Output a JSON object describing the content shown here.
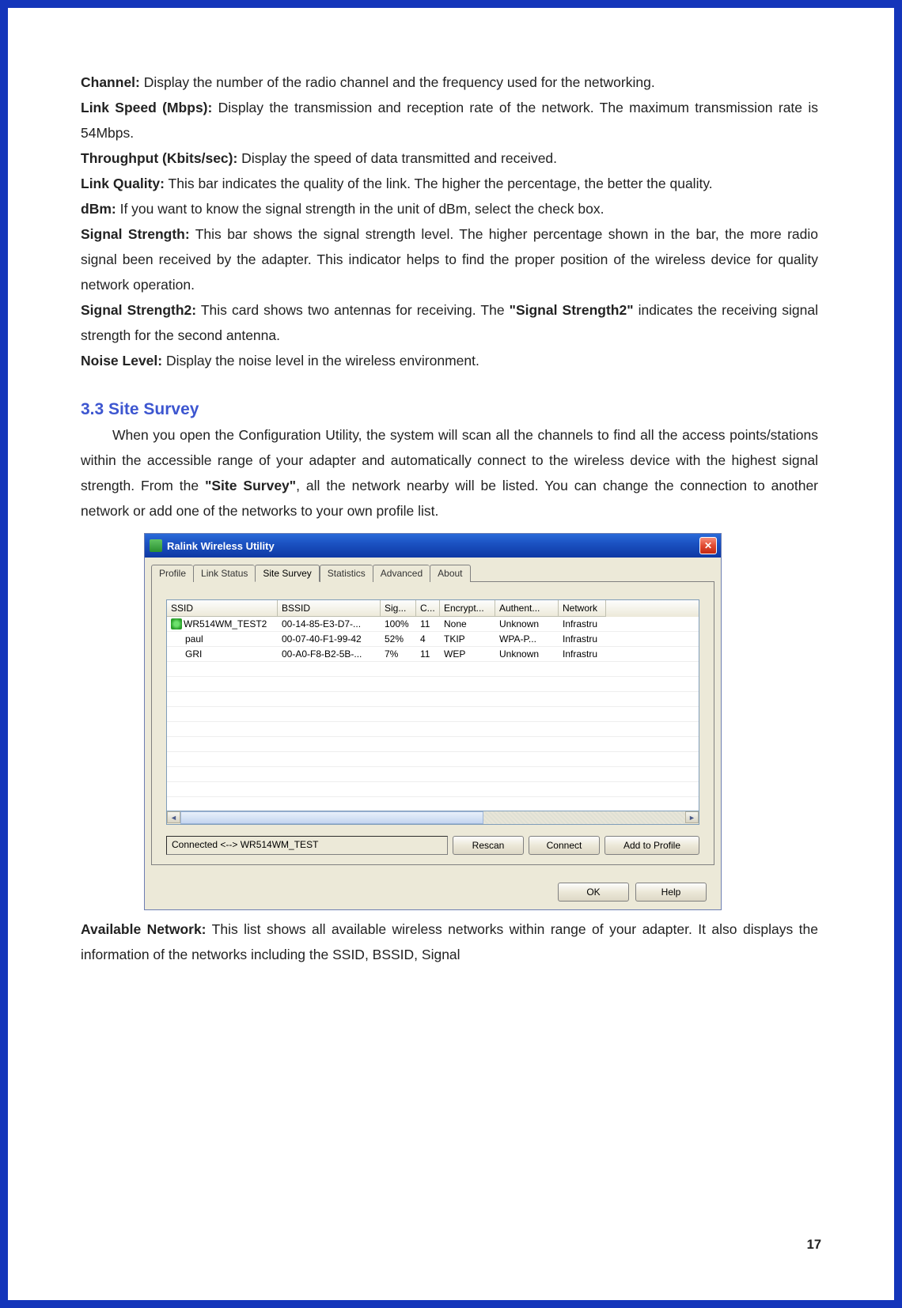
{
  "defs": [
    {
      "term": "Channel:",
      "text": " Display the number of the radio channel and the frequency used for the networking."
    },
    {
      "term": "Link Speed (Mbps):",
      "text": " Display the transmission and reception rate of the network. The maximum transmission rate is 54Mbps."
    },
    {
      "term": "Throughput (Kbits/sec):",
      "text": " Display the speed of data transmitted and received."
    },
    {
      "term": "Link Quality:",
      "text": " This bar indicates the quality of the link. The higher the percentage, the better the quality."
    },
    {
      "term": "dBm:",
      "text": " If you want to know the signal strength in the unit of dBm, select the check box."
    },
    {
      "term": "Signal Strength:",
      "text": " This bar shows the signal strength level. The higher percentage shown in the bar, the more radio signal been received by the adapter. This indicator helps to find the proper position of the wireless device for quality network operation."
    },
    {
      "term": "Signal Strength2:",
      "text_pre": " This card shows two antennas for receiving. The ",
      "bold": "\"Signal Strength2\"",
      "text_post": " indicates the receiving signal strength for the second antenna."
    },
    {
      "term": "Noise Level:",
      "text": " Display the noise level in the wireless environment."
    }
  ],
  "section": {
    "num": "3.3",
    "title": "Site Survey"
  },
  "section_text": {
    "pre": "When you open the Configuration Utility, the system will scan all the channels to find all the access points/stations within the accessible range of your adapter and automatically connect to the wireless device with the highest signal strength. From the ",
    "bold": "\"Site Survey\"",
    "post": ", all the network nearby will be listed. You can change the connection to another network or add one of the networks to your own profile list."
  },
  "window": {
    "title": "Ralink Wireless Utility",
    "tabs": [
      "Profile",
      "Link Status",
      "Site Survey",
      "Statistics",
      "Advanced",
      "About"
    ],
    "active_tab": 2,
    "columns": [
      "SSID",
      "BSSID",
      "Sig...",
      "C...",
      "Encrypt...",
      "Authent...",
      "Network"
    ],
    "rows": [
      {
        "connected": true,
        "ssid": "WR514WM_TEST2",
        "bssid": "00-14-85-E3-D7-...",
        "sig": "100%",
        "ch": "11",
        "enc": "None",
        "auth": "Unknown",
        "net": "Infrastru"
      },
      {
        "connected": false,
        "ssid": "paul",
        "bssid": "00-07-40-F1-99-42",
        "sig": "52%",
        "ch": "4",
        "enc": "TKIP",
        "auth": "WPA-P...",
        "net": "Infrastru"
      },
      {
        "connected": false,
        "ssid": "GRI",
        "bssid": "00-A0-F8-B2-5B-...",
        "sig": "7%",
        "ch": "11",
        "enc": "WEP",
        "auth": "Unknown",
        "net": "Infrastru"
      }
    ],
    "status": "Connected <--> WR514WM_TEST",
    "buttons": {
      "rescan": "Rescan",
      "connect": "Connect",
      "add": "Add to Profile",
      "ok": "OK",
      "help": "Help"
    }
  },
  "after_text": {
    "term": "Available Network:",
    "text": " This list shows all available wireless networks within range of your adapter. It also displays the information of the networks including the SSID, BSSID, Signal"
  },
  "page_number": "17"
}
